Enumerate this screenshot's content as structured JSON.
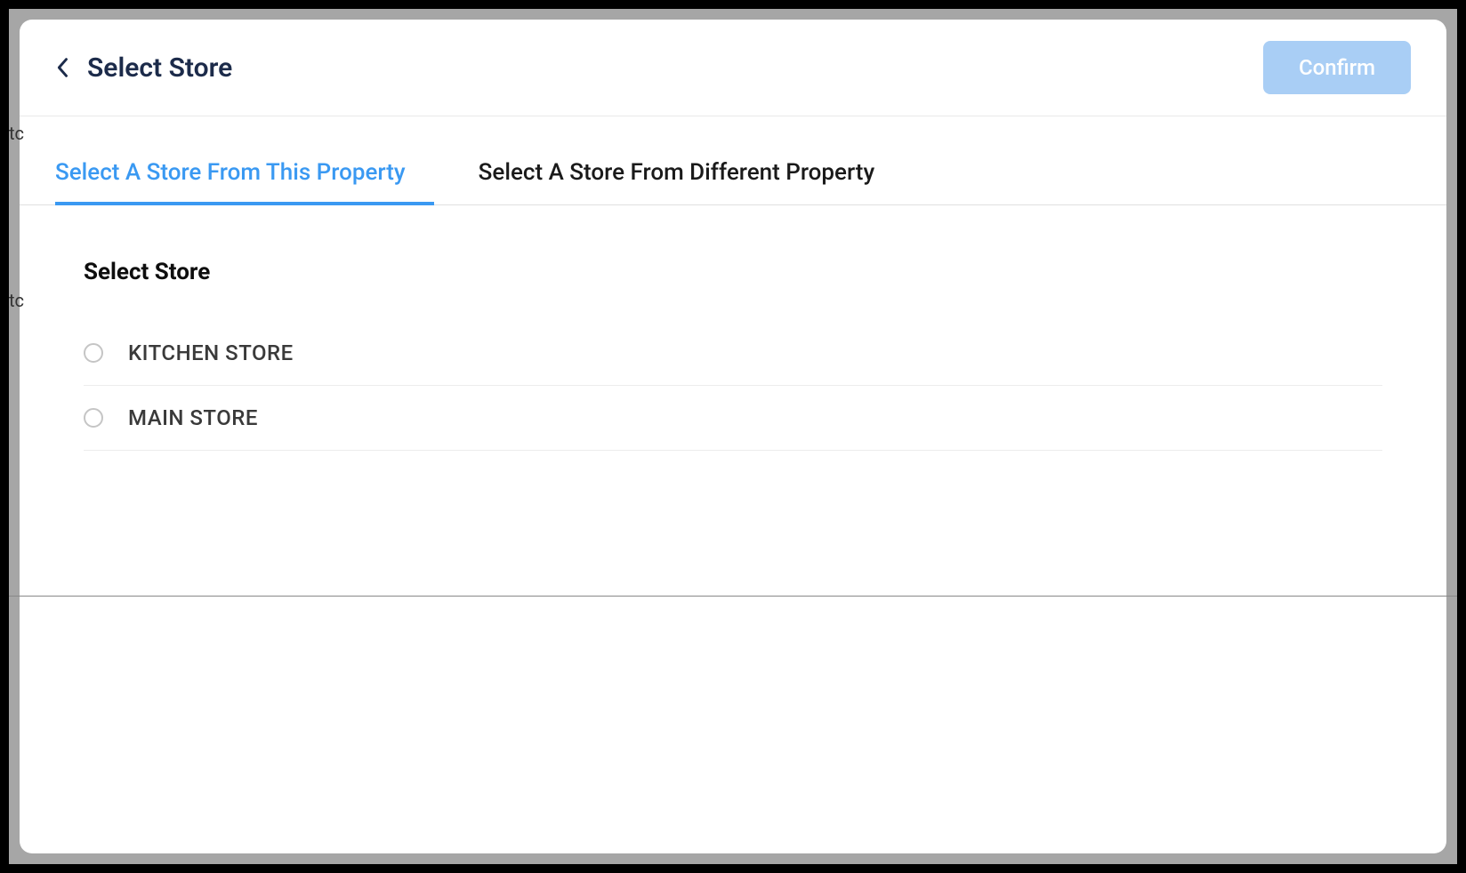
{
  "header": {
    "title": "Select Store",
    "confirm_label": "Confirm"
  },
  "tabs": [
    {
      "label": "Select A Store From This Property",
      "active": true
    },
    {
      "label": "Select A Store From Different Property",
      "active": false
    }
  ],
  "section_title": "Select Store",
  "stores": [
    {
      "label": "KITCHEN STORE"
    },
    {
      "label": "MAIN STORE"
    }
  ],
  "bg_text_1": "tc",
  "bg_text_2": "tc"
}
